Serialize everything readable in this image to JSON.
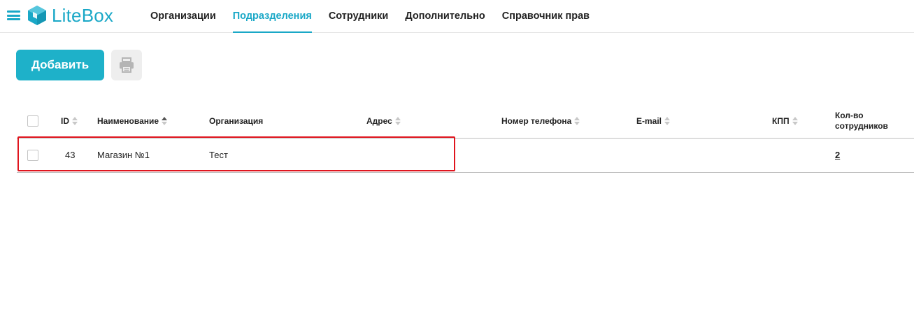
{
  "header": {
    "logo_text": "LiteBox",
    "nav": [
      {
        "label": "Организации",
        "active": false
      },
      {
        "label": "Подразделения",
        "active": true
      },
      {
        "label": "Сотрудники",
        "active": false
      },
      {
        "label": "Дополнительно",
        "active": false
      },
      {
        "label": "Справочник прав",
        "active": false
      }
    ]
  },
  "toolbar": {
    "add_label": "Добавить",
    "print_icon": "printer-icon"
  },
  "table": {
    "columns": {
      "id": "ID",
      "name": "Наименование",
      "org": "Организация",
      "address": "Адрес",
      "phone": "Номер телефона",
      "email": "E-mail",
      "kpp": "КПП",
      "count_line1": "Кол-во",
      "count_line2": "сотрудников"
    },
    "sorted_column": "name",
    "sort_direction": "asc",
    "rows": [
      {
        "id": "43",
        "name": "Магазин №1",
        "org": "Тест",
        "address": "",
        "phone": "",
        "email": "",
        "kpp": "",
        "count": "2"
      }
    ]
  },
  "colors": {
    "accent": "#1aa8c7",
    "button": "#1eb1c9",
    "highlight": "#e0151e"
  }
}
